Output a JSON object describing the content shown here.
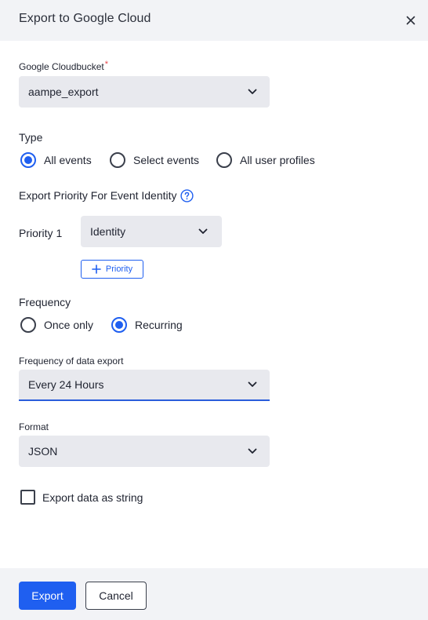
{
  "dialog": {
    "title": "Export to Google Cloud",
    "close_icon": "close-icon"
  },
  "bucket": {
    "label": "Google Cloudbucket",
    "required_mark": "*",
    "value": "aampe_export"
  },
  "type": {
    "label": "Type",
    "options": [
      {
        "label": "All events",
        "selected": true
      },
      {
        "label": "Select events",
        "selected": false
      },
      {
        "label": "All user profiles",
        "selected": false
      }
    ]
  },
  "priority": {
    "heading": "Export Priority For Event Identity",
    "help_icon": "help-circle-icon",
    "row_label": "Priority 1",
    "row_value": "Identity",
    "add_label": "Priority",
    "add_icon": "plus-icon"
  },
  "frequency": {
    "label": "Frequency",
    "options": [
      {
        "label": "Once only",
        "selected": false
      },
      {
        "label": "Recurring",
        "selected": true
      }
    ],
    "export_label": "Frequency of data export",
    "export_value": "Every 24 Hours"
  },
  "format": {
    "label": "Format",
    "value": "JSON"
  },
  "string_option": {
    "label": "Export data as string",
    "checked": false
  },
  "footer": {
    "export_label": "Export",
    "cancel_label": "Cancel"
  },
  "colors": {
    "accent": "#1f5ff0",
    "header_bg": "#f2f3f6",
    "field_bg": "#e8e9ee",
    "required": "#e5484d"
  }
}
